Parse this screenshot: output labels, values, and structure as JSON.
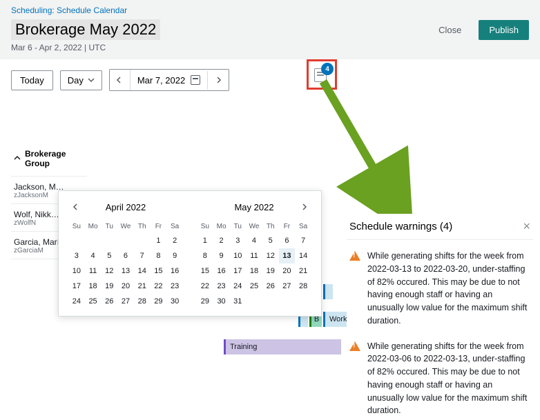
{
  "breadcrumb": "Scheduling: Schedule Calendar",
  "title": "Brokerage May 2022",
  "date_range": "Mar 6 - Apr 2, 2022 | UTC",
  "actions": {
    "close": "Close",
    "publish": "Publish"
  },
  "toolbar": {
    "today": "Today",
    "view": "Day",
    "date": "Mar 7, 2022"
  },
  "notif": {
    "count": "4"
  },
  "datepicker": {
    "month1": {
      "name": "April 2022",
      "dow": [
        "Su",
        "Mo",
        "Tu",
        "We",
        "Th",
        "Fr",
        "Sa"
      ],
      "weeks": [
        [
          "",
          "",
          "",
          "",
          "",
          "1",
          "2"
        ],
        [
          "3",
          "4",
          "5",
          "6",
          "7",
          "8",
          "9"
        ],
        [
          "10",
          "11",
          "12",
          "13",
          "14",
          "15",
          "16"
        ],
        [
          "17",
          "18",
          "19",
          "20",
          "21",
          "22",
          "23"
        ],
        [
          "24",
          "25",
          "26",
          "27",
          "28",
          "29",
          "30"
        ]
      ]
    },
    "month2": {
      "name": "May 2022",
      "dow": [
        "Su",
        "Mo",
        "Tu",
        "We",
        "Th",
        "Fr",
        "Sa"
      ],
      "weeks": [
        [
          "1",
          "2",
          "3",
          "4",
          "5",
          "6",
          "7"
        ],
        [
          "8",
          "9",
          "10",
          "11",
          "12",
          "13",
          "14"
        ],
        [
          "15",
          "16",
          "17",
          "18",
          "19",
          "20",
          "21"
        ],
        [
          "22",
          "23",
          "24",
          "25",
          "26",
          "27",
          "28"
        ],
        [
          "29",
          "30",
          "31",
          "",
          "",
          "",
          ""
        ]
      ],
      "selected": "13"
    }
  },
  "group": {
    "name": "Brokerage Group"
  },
  "agents": [
    {
      "name": "Jackson, M…",
      "sub": "zJacksonM"
    },
    {
      "name": "Wolf, Nikk…",
      "sub": "zWolfN"
    },
    {
      "name": "Garcia, María",
      "sub": "zGarciaM"
    }
  ],
  "activities": {
    "b": "B",
    "work": "Work",
    "training": "Training"
  },
  "warnings": {
    "title": "Schedule warnings (4)",
    "items": [
      "While generating shifts for the week from 2022-03-13 to 2022-03-20, under-staffing of 82% occured. This may be due to not having enough staff or having an unusually low value for the maximum shift duration.",
      "While generating shifts for the week from 2022-03-06 to 2022-03-13, under-staffing of 82% occured. This may be due to not having enough staff or having an unusually low value for the maximum shift duration."
    ]
  }
}
